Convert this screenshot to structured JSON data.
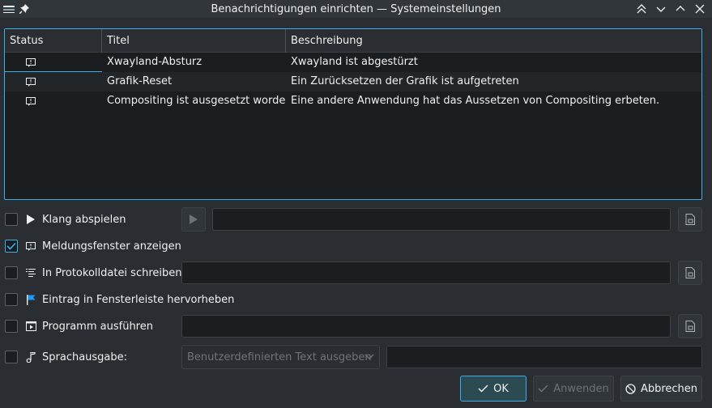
{
  "window": {
    "title": "Benachrichtigungen einrichten — Systemeinstellungen"
  },
  "table": {
    "columns": [
      "Status",
      "Titel",
      "Beschreibung"
    ],
    "rows": [
      {
        "title": "Xwayland-Absturz",
        "description": "Xwayland ist abgestürzt"
      },
      {
        "title": "Grafik-Reset",
        "description": "Ein Zurücksetzen der Grafik ist aufgetreten"
      },
      {
        "title": "Compositing ist ausgesetzt worden",
        "description": "Eine andere Anwendung hat das Aussetzen von Compositing erbeten."
      }
    ]
  },
  "options": {
    "sound": {
      "label": "Klang abspielen",
      "checked": false
    },
    "popup": {
      "label": "Meldungsfenster anzeigen",
      "checked": true
    },
    "logfile": {
      "label": "In Protokolldatei schreiben",
      "checked": false
    },
    "taskbar": {
      "label": "Eintrag in Fensterleiste hervorheben",
      "checked": false
    },
    "execute": {
      "label": "Programm ausführen",
      "checked": false
    },
    "speech": {
      "label": "Sprachausgabe:",
      "checked": false,
      "combo_value": "Benutzerdefinierten Text ausgeben"
    }
  },
  "buttons": {
    "ok": "OK",
    "apply": "Anwenden",
    "cancel": "Abbrechen"
  },
  "colors": {
    "accent": "#3daee9",
    "background": "#2a2e32",
    "field": "#1b1e20"
  }
}
